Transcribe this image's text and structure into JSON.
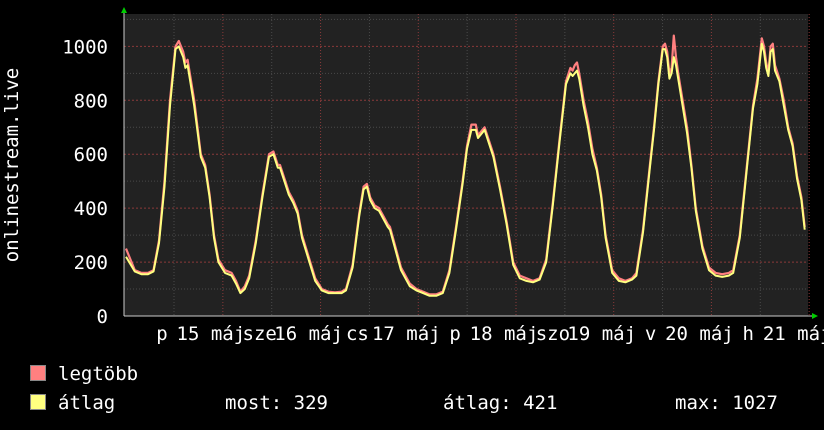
{
  "chart_data": {
    "type": "area",
    "ylabel": "onlinestream.live",
    "ylim": [
      0,
      1120
    ],
    "y_ticks": [
      0,
      200,
      400,
      600,
      800,
      1000
    ],
    "x_labels": [
      "p",
      "15 máj",
      "sze",
      "16 máj",
      "cs",
      "17 máj",
      "p",
      "18 máj",
      "szo",
      "19 máj",
      "v",
      "20 máj",
      "h",
      "21 máj"
    ],
    "grid": true,
    "series": [
      {
        "name": "legtöbb",
        "color": "#ff8080",
        "points": [
          [
            0,
            250
          ],
          [
            8,
            170
          ],
          [
            14,
            160
          ],
          [
            20,
            160
          ],
          [
            25,
            170
          ],
          [
            30,
            280
          ],
          [
            35,
            500
          ],
          [
            40,
            800
          ],
          [
            45,
            1000
          ],
          [
            48,
            1020
          ],
          [
            52,
            980
          ],
          [
            54,
            940
          ],
          [
            56,
            950
          ],
          [
            58,
            900
          ],
          [
            62,
            800
          ],
          [
            68,
            600
          ],
          [
            72,
            560
          ],
          [
            76,
            450
          ],
          [
            80,
            300
          ],
          [
            84,
            210
          ],
          [
            90,
            170
          ],
          [
            96,
            160
          ],
          [
            100,
            130
          ],
          [
            104,
            90
          ],
          [
            108,
            110
          ],
          [
            112,
            150
          ],
          [
            118,
            280
          ],
          [
            124,
            450
          ],
          [
            130,
            600
          ],
          [
            134,
            610
          ],
          [
            138,
            560
          ],
          [
            140,
            560
          ],
          [
            144,
            510
          ],
          [
            148,
            460
          ],
          [
            152,
            430
          ],
          [
            156,
            390
          ],
          [
            160,
            300
          ],
          [
            166,
            220
          ],
          [
            172,
            140
          ],
          [
            178,
            100
          ],
          [
            184,
            90
          ],
          [
            190,
            88
          ],
          [
            196,
            90
          ],
          [
            200,
            100
          ],
          [
            206,
            190
          ],
          [
            212,
            380
          ],
          [
            216,
            480
          ],
          [
            219,
            490
          ],
          [
            222,
            440
          ],
          [
            226,
            410
          ],
          [
            230,
            400
          ],
          [
            234,
            370
          ],
          [
            238,
            340
          ],
          [
            240,
            330
          ],
          [
            244,
            270
          ],
          [
            250,
            180
          ],
          [
            258,
            120
          ],
          [
            264,
            100
          ],
          [
            270,
            90
          ],
          [
            276,
            80
          ],
          [
            282,
            80
          ],
          [
            288,
            90
          ],
          [
            294,
            170
          ],
          [
            300,
            330
          ],
          [
            306,
            500
          ],
          [
            310,
            630
          ],
          [
            314,
            710
          ],
          [
            318,
            710
          ],
          [
            320,
            670
          ],
          [
            324,
            690
          ],
          [
            326,
            700
          ],
          [
            330,
            650
          ],
          [
            334,
            600
          ],
          [
            340,
            480
          ],
          [
            346,
            350
          ],
          [
            352,
            200
          ],
          [
            358,
            150
          ],
          [
            364,
            140
          ],
          [
            370,
            130
          ],
          [
            376,
            140
          ],
          [
            382,
            210
          ],
          [
            388,
            420
          ],
          [
            394,
            650
          ],
          [
            400,
            870
          ],
          [
            404,
            920
          ],
          [
            406,
            910
          ],
          [
            408,
            930
          ],
          [
            410,
            940
          ],
          [
            412,
            900
          ],
          [
            416,
            800
          ],
          [
            420,
            720
          ],
          [
            424,
            620
          ],
          [
            428,
            550
          ],
          [
            432,
            450
          ],
          [
            436,
            300
          ],
          [
            442,
            170
          ],
          [
            448,
            140
          ],
          [
            454,
            130
          ],
          [
            460,
            140
          ],
          [
            464,
            160
          ],
          [
            470,
            320
          ],
          [
            476,
            550
          ],
          [
            480,
            700
          ],
          [
            484,
            870
          ],
          [
            488,
            1000
          ],
          [
            490,
            1010
          ],
          [
            492,
            980
          ],
          [
            494,
            900
          ],
          [
            496,
            920
          ],
          [
            498,
            1040
          ],
          [
            500,
            960
          ],
          [
            502,
            900
          ],
          [
            506,
            800
          ],
          [
            510,
            700
          ],
          [
            514,
            560
          ],
          [
            518,
            400
          ],
          [
            524,
            260
          ],
          [
            530,
            180
          ],
          [
            536,
            160
          ],
          [
            542,
            155
          ],
          [
            548,
            160
          ],
          [
            552,
            170
          ],
          [
            558,
            300
          ],
          [
            564,
            540
          ],
          [
            570,
            780
          ],
          [
            574,
            880
          ],
          [
            578,
            1030
          ],
          [
            580,
            1000
          ],
          [
            582,
            940
          ],
          [
            584,
            900
          ],
          [
            586,
            1000
          ],
          [
            588,
            1010
          ],
          [
            590,
            930
          ],
          [
            594,
            880
          ],
          [
            598,
            800
          ],
          [
            602,
            700
          ],
          [
            606,
            640
          ],
          [
            610,
            520
          ],
          [
            614,
            440
          ],
          [
            617,
            330
          ]
        ]
      },
      {
        "name": "átlag",
        "color": "#ffff80",
        "points": [
          [
            0,
            220
          ],
          [
            8,
            165
          ],
          [
            14,
            155
          ],
          [
            20,
            155
          ],
          [
            25,
            165
          ],
          [
            30,
            270
          ],
          [
            35,
            480
          ],
          [
            40,
            780
          ],
          [
            45,
            990
          ],
          [
            48,
            1000
          ],
          [
            52,
            960
          ],
          [
            54,
            920
          ],
          [
            56,
            930
          ],
          [
            58,
            880
          ],
          [
            62,
            780
          ],
          [
            68,
            590
          ],
          [
            72,
            550
          ],
          [
            76,
            440
          ],
          [
            80,
            290
          ],
          [
            84,
            200
          ],
          [
            90,
            160
          ],
          [
            96,
            150
          ],
          [
            100,
            120
          ],
          [
            104,
            85
          ],
          [
            108,
            100
          ],
          [
            112,
            140
          ],
          [
            118,
            270
          ],
          [
            124,
            440
          ],
          [
            130,
            590
          ],
          [
            134,
            600
          ],
          [
            138,
            550
          ],
          [
            140,
            550
          ],
          [
            144,
            500
          ],
          [
            148,
            450
          ],
          [
            152,
            420
          ],
          [
            156,
            380
          ],
          [
            160,
            290
          ],
          [
            166,
            210
          ],
          [
            172,
            130
          ],
          [
            178,
            95
          ],
          [
            184,
            85
          ],
          [
            190,
            85
          ],
          [
            196,
            85
          ],
          [
            200,
            95
          ],
          [
            206,
            180
          ],
          [
            212,
            370
          ],
          [
            216,
            470
          ],
          [
            219,
            480
          ],
          [
            222,
            430
          ],
          [
            226,
            400
          ],
          [
            230,
            390
          ],
          [
            234,
            360
          ],
          [
            238,
            330
          ],
          [
            240,
            320
          ],
          [
            244,
            260
          ],
          [
            250,
            170
          ],
          [
            258,
            110
          ],
          [
            264,
            95
          ],
          [
            270,
            85
          ],
          [
            276,
            75
          ],
          [
            282,
            75
          ],
          [
            288,
            85
          ],
          [
            294,
            160
          ],
          [
            300,
            320
          ],
          [
            306,
            490
          ],
          [
            310,
            620
          ],
          [
            314,
            690
          ],
          [
            318,
            690
          ],
          [
            320,
            660
          ],
          [
            324,
            680
          ],
          [
            326,
            690
          ],
          [
            330,
            640
          ],
          [
            334,
            590
          ],
          [
            340,
            470
          ],
          [
            346,
            340
          ],
          [
            352,
            190
          ],
          [
            358,
            140
          ],
          [
            364,
            130
          ],
          [
            370,
            125
          ],
          [
            376,
            135
          ],
          [
            382,
            200
          ],
          [
            388,
            410
          ],
          [
            394,
            640
          ],
          [
            400,
            860
          ],
          [
            404,
            900
          ],
          [
            406,
            890
          ],
          [
            408,
            900
          ],
          [
            410,
            910
          ],
          [
            412,
            880
          ],
          [
            416,
            780
          ],
          [
            420,
            700
          ],
          [
            424,
            600
          ],
          [
            428,
            540
          ],
          [
            432,
            440
          ],
          [
            436,
            290
          ],
          [
            442,
            160
          ],
          [
            448,
            130
          ],
          [
            454,
            125
          ],
          [
            460,
            135
          ],
          [
            464,
            150
          ],
          [
            470,
            310
          ],
          [
            476,
            540
          ],
          [
            480,
            690
          ],
          [
            484,
            860
          ],
          [
            488,
            990
          ],
          [
            490,
            990
          ],
          [
            492,
            960
          ],
          [
            494,
            880
          ],
          [
            496,
            900
          ],
          [
            498,
            960
          ],
          [
            500,
            930
          ],
          [
            502,
            880
          ],
          [
            506,
            780
          ],
          [
            510,
            680
          ],
          [
            514,
            550
          ],
          [
            518,
            390
          ],
          [
            524,
            250
          ],
          [
            530,
            170
          ],
          [
            536,
            150
          ],
          [
            542,
            145
          ],
          [
            548,
            150
          ],
          [
            552,
            160
          ],
          [
            558,
            290
          ],
          [
            564,
            530
          ],
          [
            570,
            770
          ],
          [
            574,
            860
          ],
          [
            578,
            1010
          ],
          [
            580,
            980
          ],
          [
            582,
            920
          ],
          [
            584,
            890
          ],
          [
            586,
            980
          ],
          [
            588,
            990
          ],
          [
            590,
            910
          ],
          [
            594,
            870
          ],
          [
            598,
            780
          ],
          [
            602,
            690
          ],
          [
            606,
            630
          ],
          [
            610,
            510
          ],
          [
            614,
            430
          ],
          [
            617,
            320
          ]
        ]
      }
    ]
  },
  "legend": [
    {
      "label": "legtöbb",
      "color": "#ff8080"
    },
    {
      "label": "átlag",
      "color": "#ffff80"
    }
  ],
  "stats": {
    "now_label": "most:",
    "now_value": "329",
    "avg_label": "átlag:",
    "avg_value": "421",
    "max_label": "max:",
    "max_value": "1027"
  }
}
